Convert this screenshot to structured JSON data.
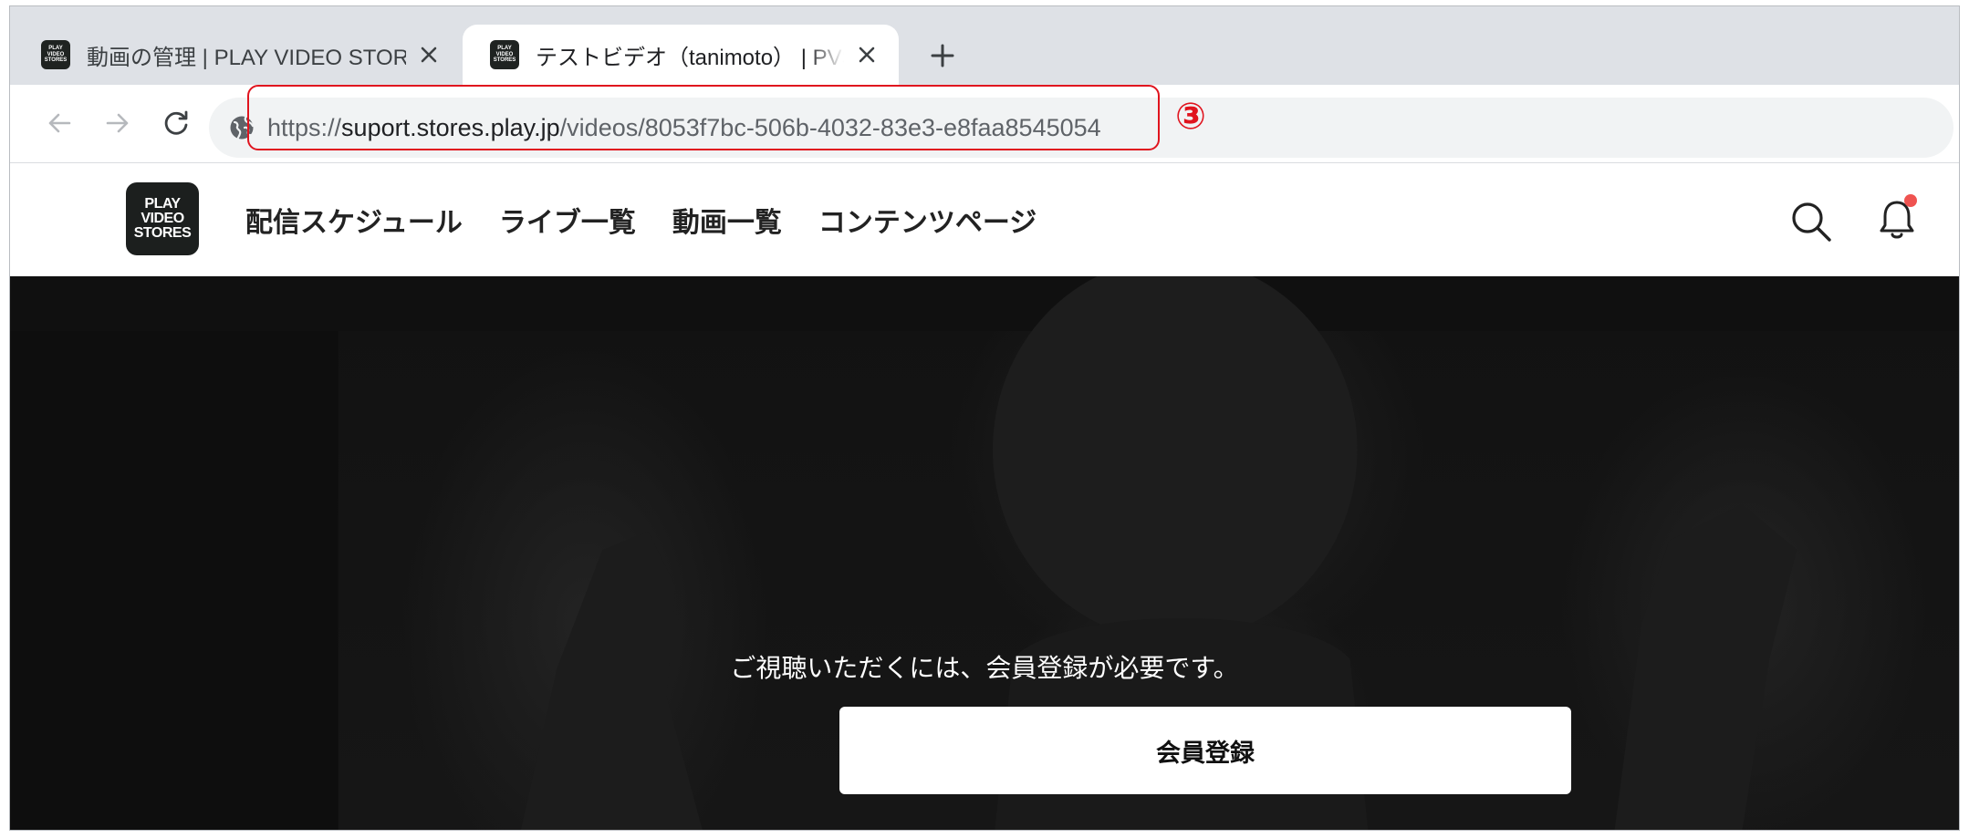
{
  "browser": {
    "tabs": [
      {
        "title": "動画の管理 | PLAY VIDEO STORES",
        "active": false
      },
      {
        "title": "テストビデオ（tanimoto） | PVS Support",
        "active": true
      }
    ],
    "favicon_lines": [
      "PLAY",
      "VIDEO",
      "STORES"
    ],
    "url": {
      "scheme": "https://",
      "host": "suport.stores.play.jp",
      "path": "/videos/8053f7bc-506b-4032-83e3-e8faa8545054"
    }
  },
  "annotation": {
    "marker": "③",
    "color": "#e0141e"
  },
  "site": {
    "logo_lines": [
      "PLAY",
      "VIDEO",
      "STORES"
    ],
    "nav": [
      {
        "label": "配信スケジュール"
      },
      {
        "label": "ライブ一覧"
      },
      {
        "label": "動画一覧"
      },
      {
        "label": "コンテンツページ"
      }
    ],
    "icons": [
      "search-icon",
      "bell-icon"
    ],
    "notification_color": "#ef5350"
  },
  "hero": {
    "message": "ご視聴いただくには、会員登録が必要です。",
    "button_label": "会員登録"
  }
}
